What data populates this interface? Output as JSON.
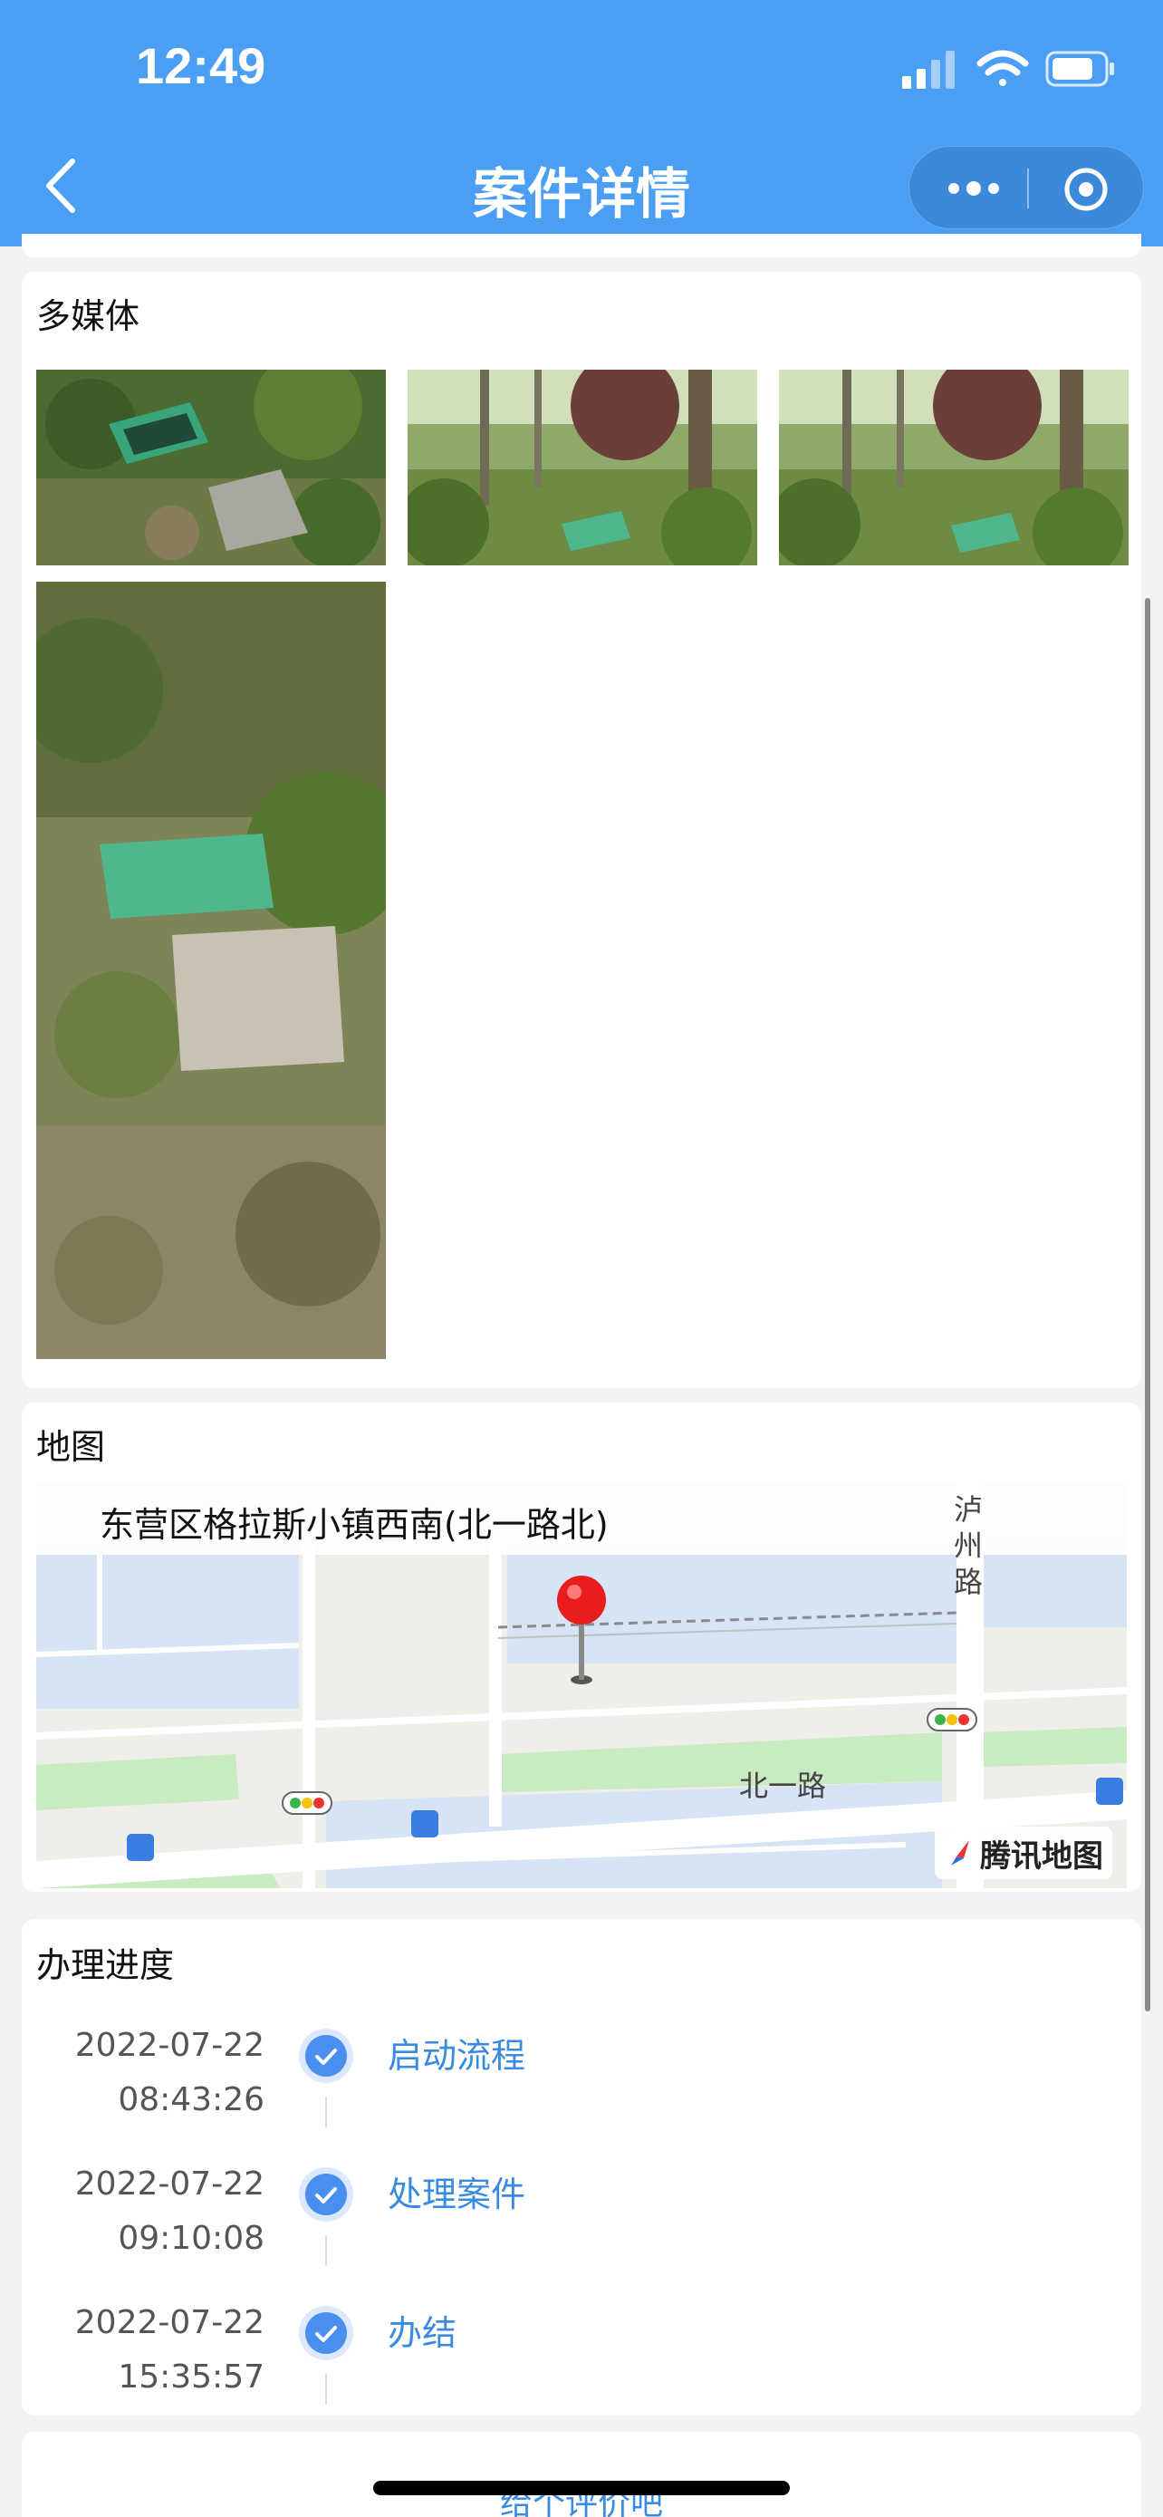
{
  "status_bar": {
    "time": "12:49"
  },
  "nav": {
    "title": "案件详情"
  },
  "media_section": {
    "title": "多媒体",
    "photos": [
      {
        "alt": "photo-1"
      },
      {
        "alt": "photo-2"
      },
      {
        "alt": "photo-3"
      },
      {
        "alt": "photo-4"
      }
    ]
  },
  "map_section": {
    "title": "地图",
    "address": "东营区格拉斯小镇西南(北一路北)",
    "road_north_one": "北一路",
    "road_luzhou": "泸州路",
    "logo": "腾讯地图"
  },
  "progress_section": {
    "title": "办理进度",
    "steps": [
      {
        "date": "2022-07-22",
        "time": "08:43:26",
        "label": "启动流程"
      },
      {
        "date": "2022-07-22",
        "time": "09:10:08",
        "label": "处理案件"
      },
      {
        "date": "2022-07-22",
        "time": "15:35:57",
        "label": "办结"
      }
    ]
  },
  "footer": {
    "link": "给个评价吧"
  },
  "colors": {
    "header": "#4a9ff5",
    "accent": "#3a8ae0",
    "check": "#4a8ef0"
  }
}
